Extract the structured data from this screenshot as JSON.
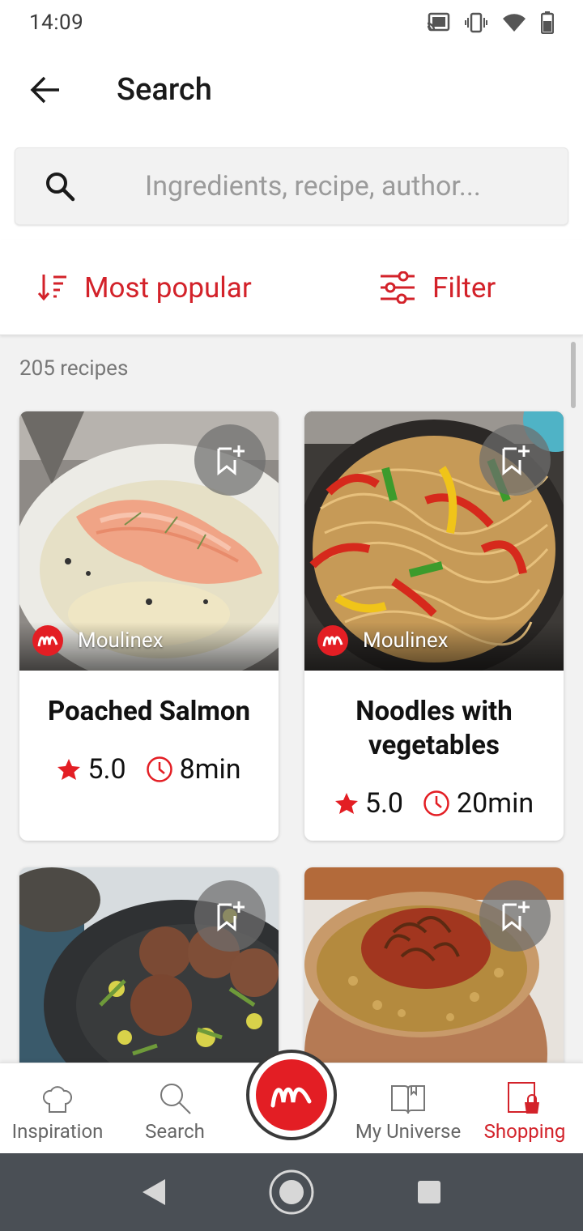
{
  "status_bar": {
    "time": "14:09"
  },
  "app_bar": {
    "title": "Search"
  },
  "search": {
    "placeholder": "Ingredients, recipe, author..."
  },
  "controls": {
    "sort_label": "Most popular",
    "filter_label": "Filter"
  },
  "results": {
    "count_text": "205 recipes",
    "recipes": [
      {
        "title": "Poached Salmon",
        "brand": "Moulinex",
        "rating": "5.0",
        "time": "8min"
      },
      {
        "title": "Noodles with vegetables",
        "brand": "Moulinex",
        "rating": "5.0",
        "time": "20min"
      },
      {
        "title": "",
        "brand": "",
        "rating": "",
        "time": ""
      },
      {
        "title": "",
        "brand": "",
        "rating": "",
        "time": ""
      }
    ]
  },
  "bottom_nav": {
    "items": [
      {
        "label": "Inspiration"
      },
      {
        "label": "Search"
      },
      {
        "label": "My Universe"
      },
      {
        "label": "Shopping"
      }
    ],
    "active": "Shopping"
  },
  "colors": {
    "accent": "#d3222a",
    "brand_red": "#e31e24"
  },
  "icons": [
    "back-arrow-icon",
    "search-icon",
    "sort-icon",
    "filter-icon",
    "bookmark-add-icon",
    "star-icon",
    "clock-icon",
    "chef-hat-icon",
    "book-icon",
    "shopping-bag-icon"
  ]
}
